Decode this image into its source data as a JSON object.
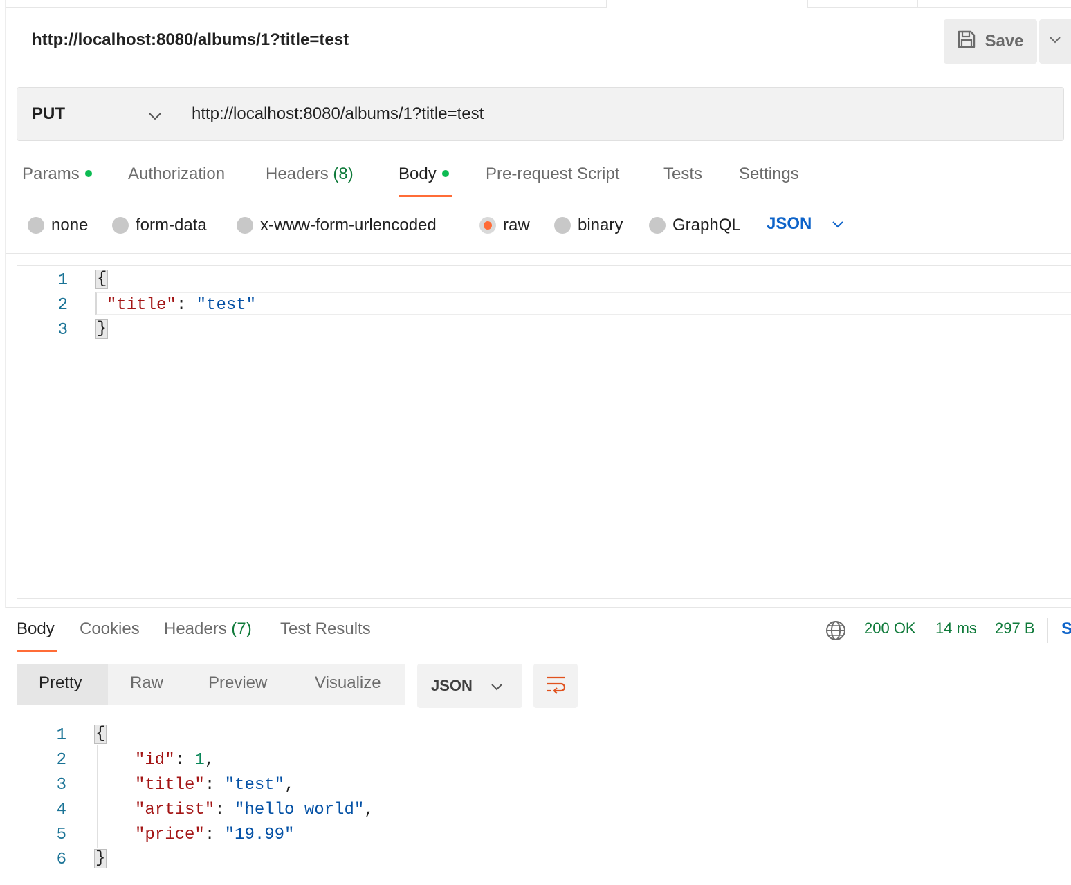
{
  "request": {
    "title": "http://localhost:8080/albums/1?title=test",
    "save_label": "Save",
    "method": "PUT",
    "url": "http://localhost:8080/albums/1?title=test"
  },
  "request_tabs": {
    "params": "Params",
    "authorization": "Authorization",
    "headers": "Headers",
    "headers_count": "(8)",
    "body": "Body",
    "prerequest": "Pre-request Script",
    "tests": "Tests",
    "settings": "Settings"
  },
  "body_modes": {
    "none": "none",
    "form_data": "form-data",
    "urlencoded": "x-www-form-urlencoded",
    "raw": "raw",
    "binary": "binary",
    "graphql": "GraphQL",
    "language": "JSON",
    "selected": "raw"
  },
  "request_editor": {
    "line_numbers": [
      "1",
      "2",
      "3"
    ],
    "open_brace": "{",
    "key": "\"title\"",
    "colon": ":",
    "value": "\"test\"",
    "close_brace": "}"
  },
  "response_tabs": {
    "body": "Body",
    "cookies": "Cookies",
    "headers": "Headers",
    "headers_count": "(7)",
    "test_results": "Test Results"
  },
  "response_status": {
    "status": "200 OK",
    "time": "14 ms",
    "size": "297 B",
    "edge_label": "S"
  },
  "response_view": {
    "pretty": "Pretty",
    "raw": "Raw",
    "preview": "Preview",
    "visualize": "Visualize",
    "format": "JSON"
  },
  "response_editor": {
    "line_numbers": [
      "1",
      "2",
      "3",
      "4",
      "5",
      "6"
    ],
    "open_brace": "{",
    "close_brace": "}",
    "fields": [
      {
        "key": "\"id\"",
        "value": "1",
        "value_type": "number",
        "trail": ","
      },
      {
        "key": "\"title\"",
        "value": "\"test\"",
        "value_type": "string",
        "trail": ","
      },
      {
        "key": "\"artist\"",
        "value": "\"hello world\"",
        "value_type": "string",
        "trail": ","
      },
      {
        "key": "\"price\"",
        "value": "\"19.99\"",
        "value_type": "string",
        "trail": ""
      }
    ]
  },
  "colors": {
    "accent_orange": "#ff6c37",
    "status_green": "#0f7a3a",
    "link_blue": "#0d63c9",
    "json_key": "#a31515",
    "json_string": "#0451a5",
    "json_number": "#098658"
  }
}
